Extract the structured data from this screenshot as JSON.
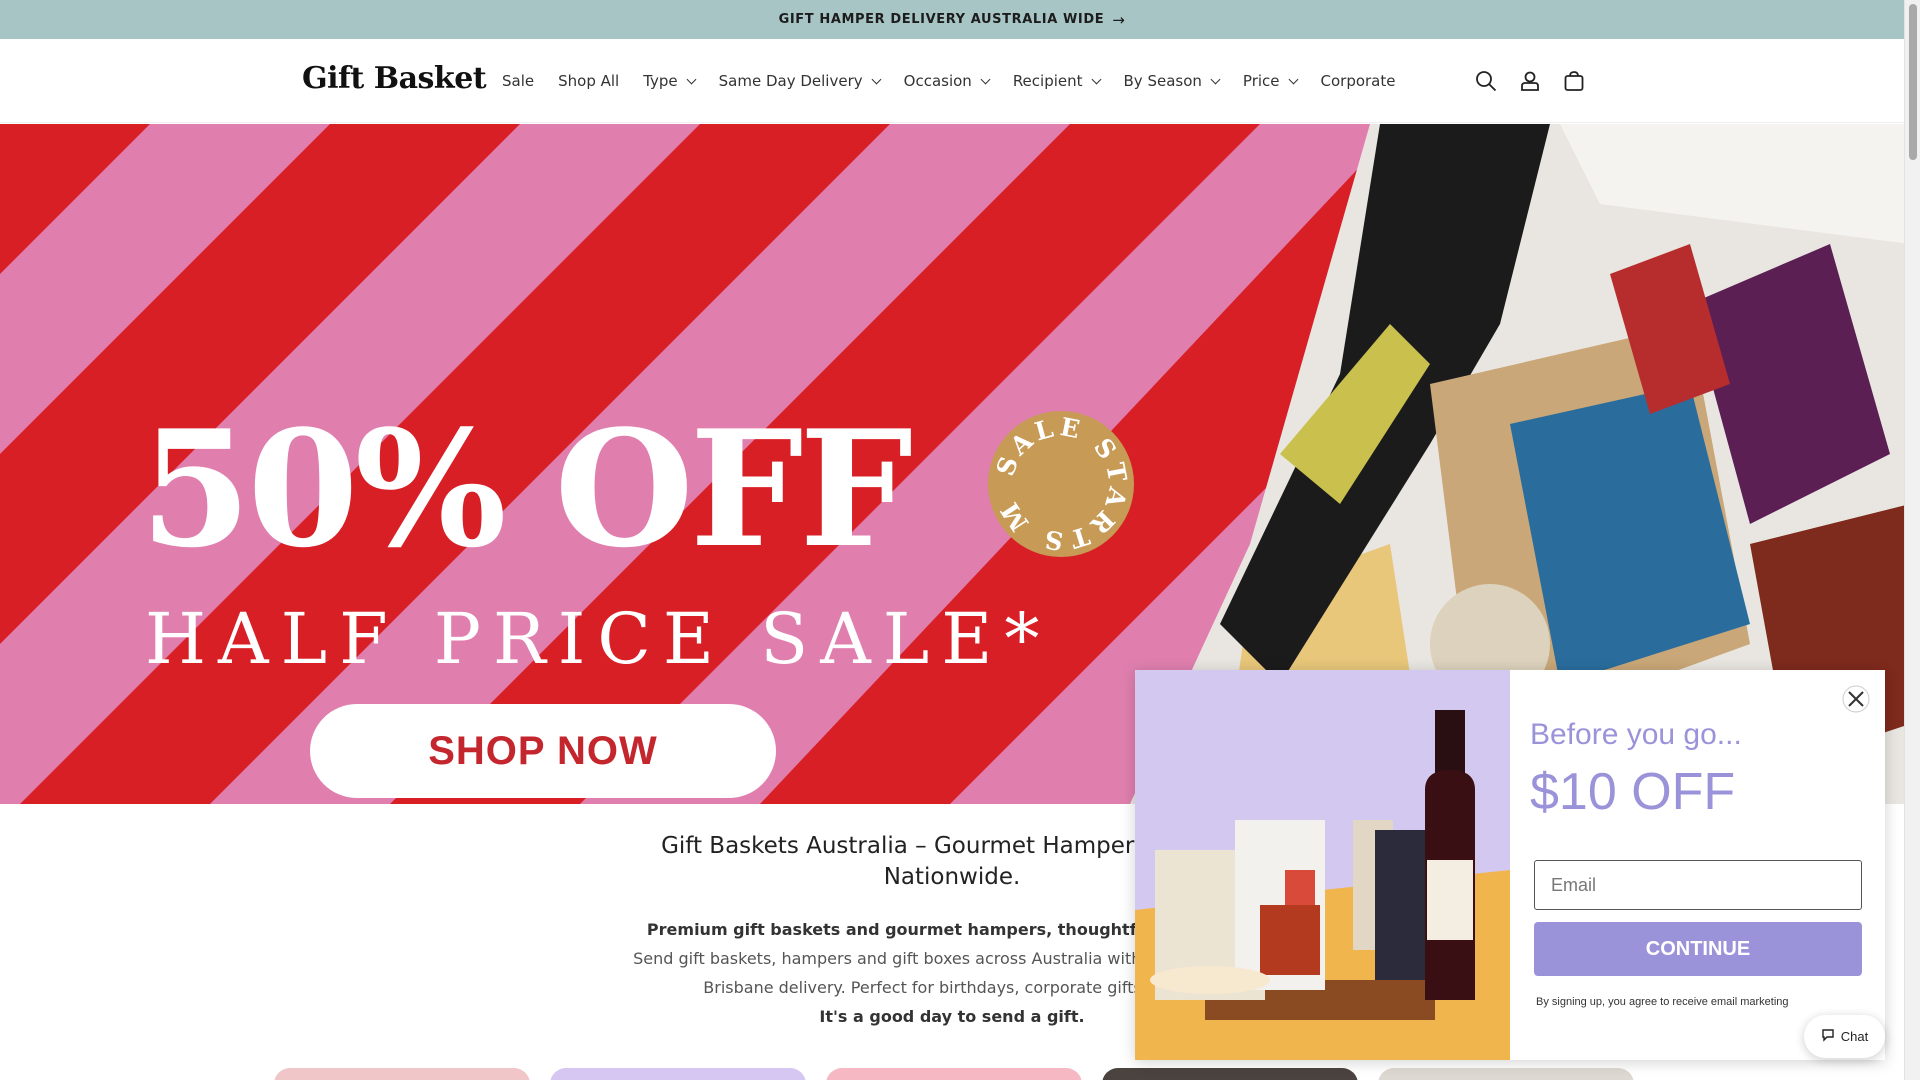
{
  "announcement": {
    "text": "GIFT HAMPER DELIVERY AUSTRALIA WIDE",
    "arrow": "→"
  },
  "header": {
    "logo": "Gift Basket",
    "nav": [
      {
        "label": "Sale",
        "has_dropdown": false
      },
      {
        "label": "Shop All",
        "has_dropdown": false
      },
      {
        "label": "Type",
        "has_dropdown": true
      },
      {
        "label": "Same Day Delivery",
        "has_dropdown": true
      },
      {
        "label": "Occasion",
        "has_dropdown": true
      },
      {
        "label": "Recipient",
        "has_dropdown": true
      },
      {
        "label": "By Season",
        "has_dropdown": true
      },
      {
        "label": "Price",
        "has_dropdown": true
      },
      {
        "label": "Corporate",
        "has_dropdown": false
      }
    ],
    "icons": [
      "search-icon",
      "account-icon",
      "cart-icon"
    ]
  },
  "hero": {
    "headline": "50% OFF",
    "subheadline": "HALF PRICE SALE*",
    "badge": "SALE STARTS MON",
    "cta": "SHOP NOW",
    "colors": {
      "red": "#d81f26",
      "pink": "#e07fae",
      "badge": "#c79a55"
    }
  },
  "intro": {
    "title": "Gift Baskets Australia – Gourmet Hampers & Gift B",
    "title_line2": "Nationwide.",
    "line1": "Premium gift baskets and gourmet hampers, thoughtfully curated f",
    "line2": "Send gift baskets, hampers and gift boxes across Australia with fast delivery op",
    "line3": "Brisbane delivery. Perfect for birthdays, corporate gifts and ce",
    "line4": "It's a good day to send a gift."
  },
  "popup": {
    "title": "Before you go...",
    "offer": "$10 OFF",
    "email_placeholder": "Email",
    "button": "CONTINUE",
    "legal": "By signing up, you agree to receive email marketing",
    "accent": "#9b93d9"
  },
  "chat": {
    "label": "Chat"
  }
}
